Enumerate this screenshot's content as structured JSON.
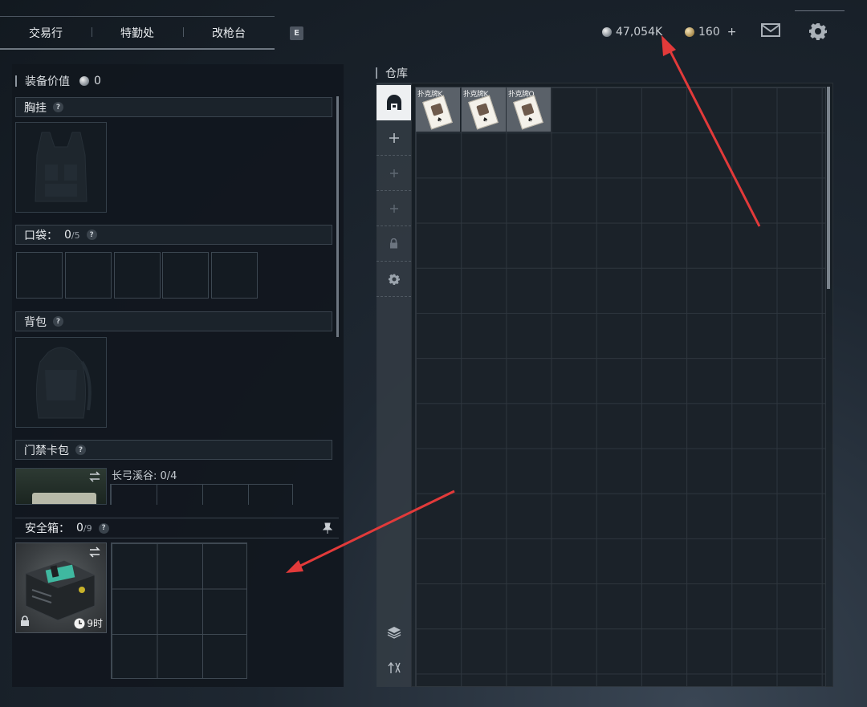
{
  "topnav": {
    "tabs": [
      {
        "label": "交易行"
      },
      {
        "label": "特勤处"
      },
      {
        "label": "改枪台"
      }
    ],
    "key_hint": "E"
  },
  "currency": {
    "silver": "47,054K",
    "gold": "160",
    "gold_add": "+"
  },
  "equipment": {
    "title": "装备价值",
    "value": "0",
    "chest_rig": {
      "label": "胸挂",
      "help": "?"
    },
    "pockets": {
      "label": "口袋：",
      "used": "0",
      "total": "/5",
      "help": "?"
    },
    "backpack": {
      "label": "背包",
      "help": "?"
    },
    "keycard_case": {
      "label": "门禁卡包",
      "help": "?",
      "map_label": "长弓溪谷: 0/4"
    },
    "safebox": {
      "label": "安全箱：",
      "used": "0",
      "total": "/9",
      "help": "?",
      "timer": "9时"
    }
  },
  "warehouse": {
    "title": "仓库",
    "items": [
      {
        "name": "扑克牌K"
      },
      {
        "name": "扑克牌K"
      },
      {
        "name": "扑克牌Q"
      }
    ]
  },
  "colors": {
    "arrow": "#e23a3a",
    "panel_bg": "#11171e",
    "grid_line": "#2e363e"
  }
}
